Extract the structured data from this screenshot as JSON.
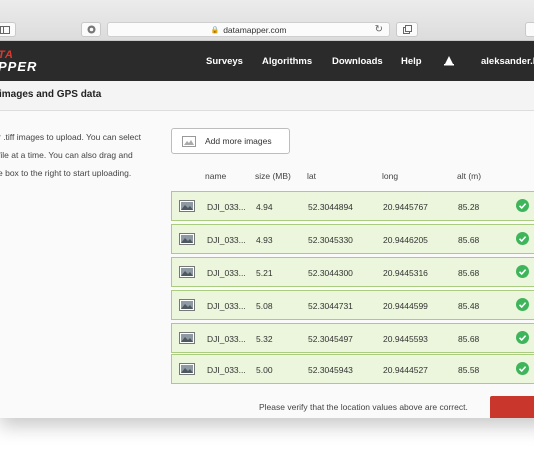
{
  "browser": {
    "url": "datamapper.com",
    "colors": {
      "chrome": "#dcdcdc"
    }
  },
  "navbar": {
    "logo_top": "TA",
    "logo_bottom": "PPER",
    "items": [
      {
        "label": "Surveys"
      },
      {
        "label": "Algorithms"
      },
      {
        "label": "Downloads"
      },
      {
        "label": "Help"
      }
    ],
    "user": "aleksander.b",
    "colors": {
      "background": "#2b2b2b",
      "logo_accent": "#d93a2f"
    }
  },
  "page": {
    "title": "images and GPS data",
    "instructions": [
      "r .tiff images to upload. You can select",
      "file at a time. You can also drag and",
      "e box to the right to start uploading."
    ],
    "add_button": "Add more images",
    "columns": {
      "name": "name",
      "size": "size (MB)",
      "lat": "lat",
      "long": "long",
      "alt": "alt (m)"
    },
    "rows": [
      {
        "name": "DJI_033...",
        "size": "4.94",
        "lat": "52.3044894",
        "long": "20.9445767",
        "alt": "85.28"
      },
      {
        "name": "DJI_033...",
        "size": "4.93",
        "lat": "52.3045330",
        "long": "20.9446205",
        "alt": "85.68"
      },
      {
        "name": "DJI_033...",
        "size": "5.21",
        "lat": "52.3044300",
        "long": "20.9445316",
        "alt": "85.68"
      },
      {
        "name": "DJI_033...",
        "size": "5.08",
        "lat": "52.3044731",
        "long": "20.9444599",
        "alt": "85.48"
      },
      {
        "name": "DJI_033...",
        "size": "5.32",
        "lat": "52.3045497",
        "long": "20.9445593",
        "alt": "85.68"
      },
      {
        "name": "DJI_033...",
        "size": "5.00",
        "lat": "52.3045943",
        "long": "20.9444527",
        "alt": "85.58"
      }
    ],
    "verify_text": "Please verify that the location values above are correct.",
    "colors": {
      "row_bg": "#ebf6dc",
      "row_border": "#a9cc7e",
      "check": "#3fb55b",
      "submit": "#c9362b"
    }
  }
}
